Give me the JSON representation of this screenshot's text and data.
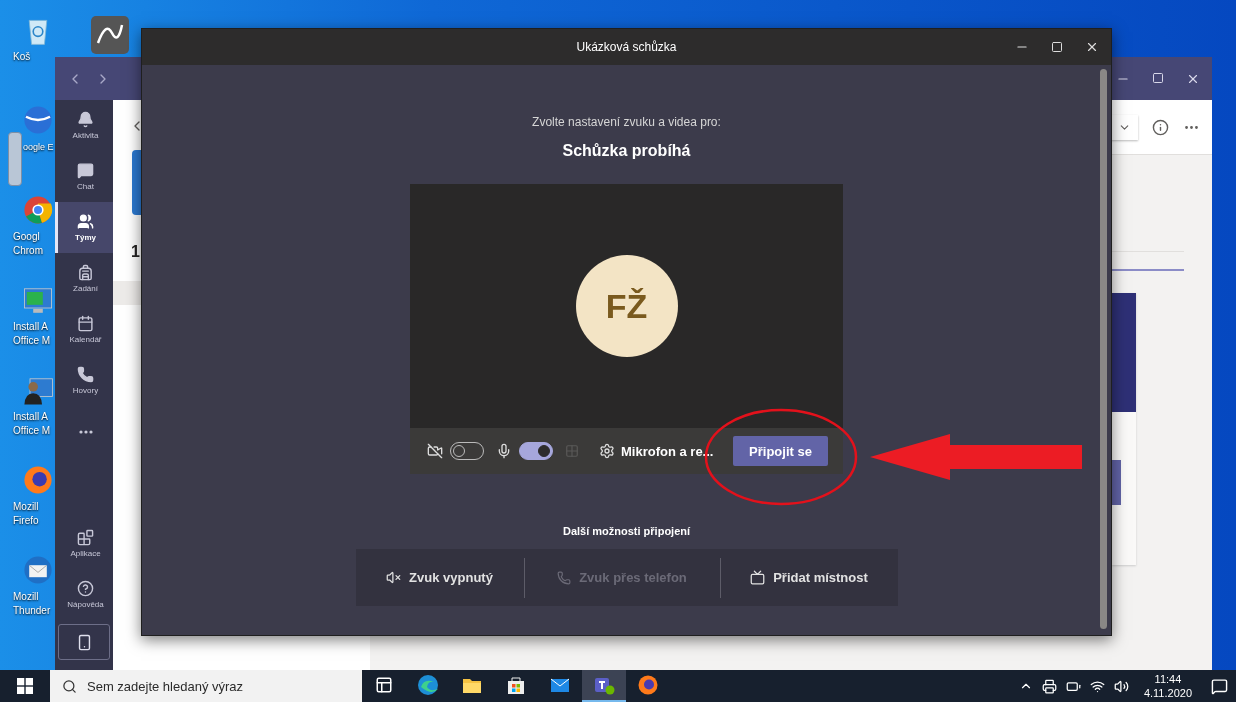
{
  "desktop": {
    "icons": [
      {
        "kind": "recycle",
        "label_lines": [
          "Koš"
        ]
      },
      {
        "kind": "globe",
        "label_lines": [
          "oogle E"
        ]
      },
      {
        "kind": "chrome",
        "label_lines": [
          "Googl",
          "Chrom"
        ]
      },
      {
        "kind": "installer",
        "label_lines": [
          "Install A",
          "Office M"
        ]
      },
      {
        "kind": "installer-user",
        "label_lines": [
          "Install A",
          "Office M"
        ]
      },
      {
        "kind": "firefox",
        "label_lines": [
          "Mozill",
          "Firefo"
        ]
      },
      {
        "kind": "thunderbird",
        "label_lines": [
          "Mozill",
          "Thunder"
        ]
      }
    ]
  },
  "teams_window": {
    "rail": [
      {
        "kind": "bell",
        "label": "Aktivita",
        "selected": false
      },
      {
        "kind": "chat",
        "label": "Chat",
        "selected": false
      },
      {
        "kind": "teams",
        "label": "Týmy",
        "selected": true
      },
      {
        "kind": "backpack",
        "label": "Zadání",
        "selected": false
      },
      {
        "kind": "calendar",
        "label": "Kalendář",
        "selected": false
      },
      {
        "kind": "phone",
        "label": "Hovory",
        "selected": false
      },
      {
        "kind": "more",
        "selected": false
      }
    ],
    "rail_bottom": [
      {
        "kind": "apps",
        "label": "Aplikace"
      },
      {
        "kind": "help",
        "label": "Nápověda"
      }
    ],
    "team_title_fragment": "1"
  },
  "meeting_window": {
    "title": "Ukázková schůzka",
    "prompt": "Zvolte nastavení zvuku a videa pro:",
    "meeting_name": "Schůzka probíhá",
    "avatar_initials": "FŽ",
    "controls": {
      "camera_on": false,
      "mic_on": true,
      "device_label": "Mikrofon a re...",
      "join_button": "Připojit se"
    },
    "other_options_heading": "Další možnosti připojení",
    "other_options": [
      {
        "kind": "audio-off",
        "label": "Zvuk vypnutý",
        "disabled": false
      },
      {
        "kind": "phone",
        "label": "Zvuk přes telefon",
        "disabled": true
      },
      {
        "kind": "room",
        "label": "Přidat místnost",
        "disabled": false
      }
    ]
  },
  "taskbar": {
    "search_placeholder": "Sem zadejte hledaný výraz",
    "apps": [
      {
        "kind": "task-view",
        "active": false
      },
      {
        "kind": "edge",
        "active": false
      },
      {
        "kind": "explorer",
        "active": false
      },
      {
        "kind": "store",
        "active": false
      },
      {
        "kind": "mail",
        "active": false
      },
      {
        "kind": "teams",
        "active": true
      },
      {
        "kind": "firefox",
        "active": false
      }
    ],
    "time": "11:44",
    "date": "4.11.2020"
  }
}
